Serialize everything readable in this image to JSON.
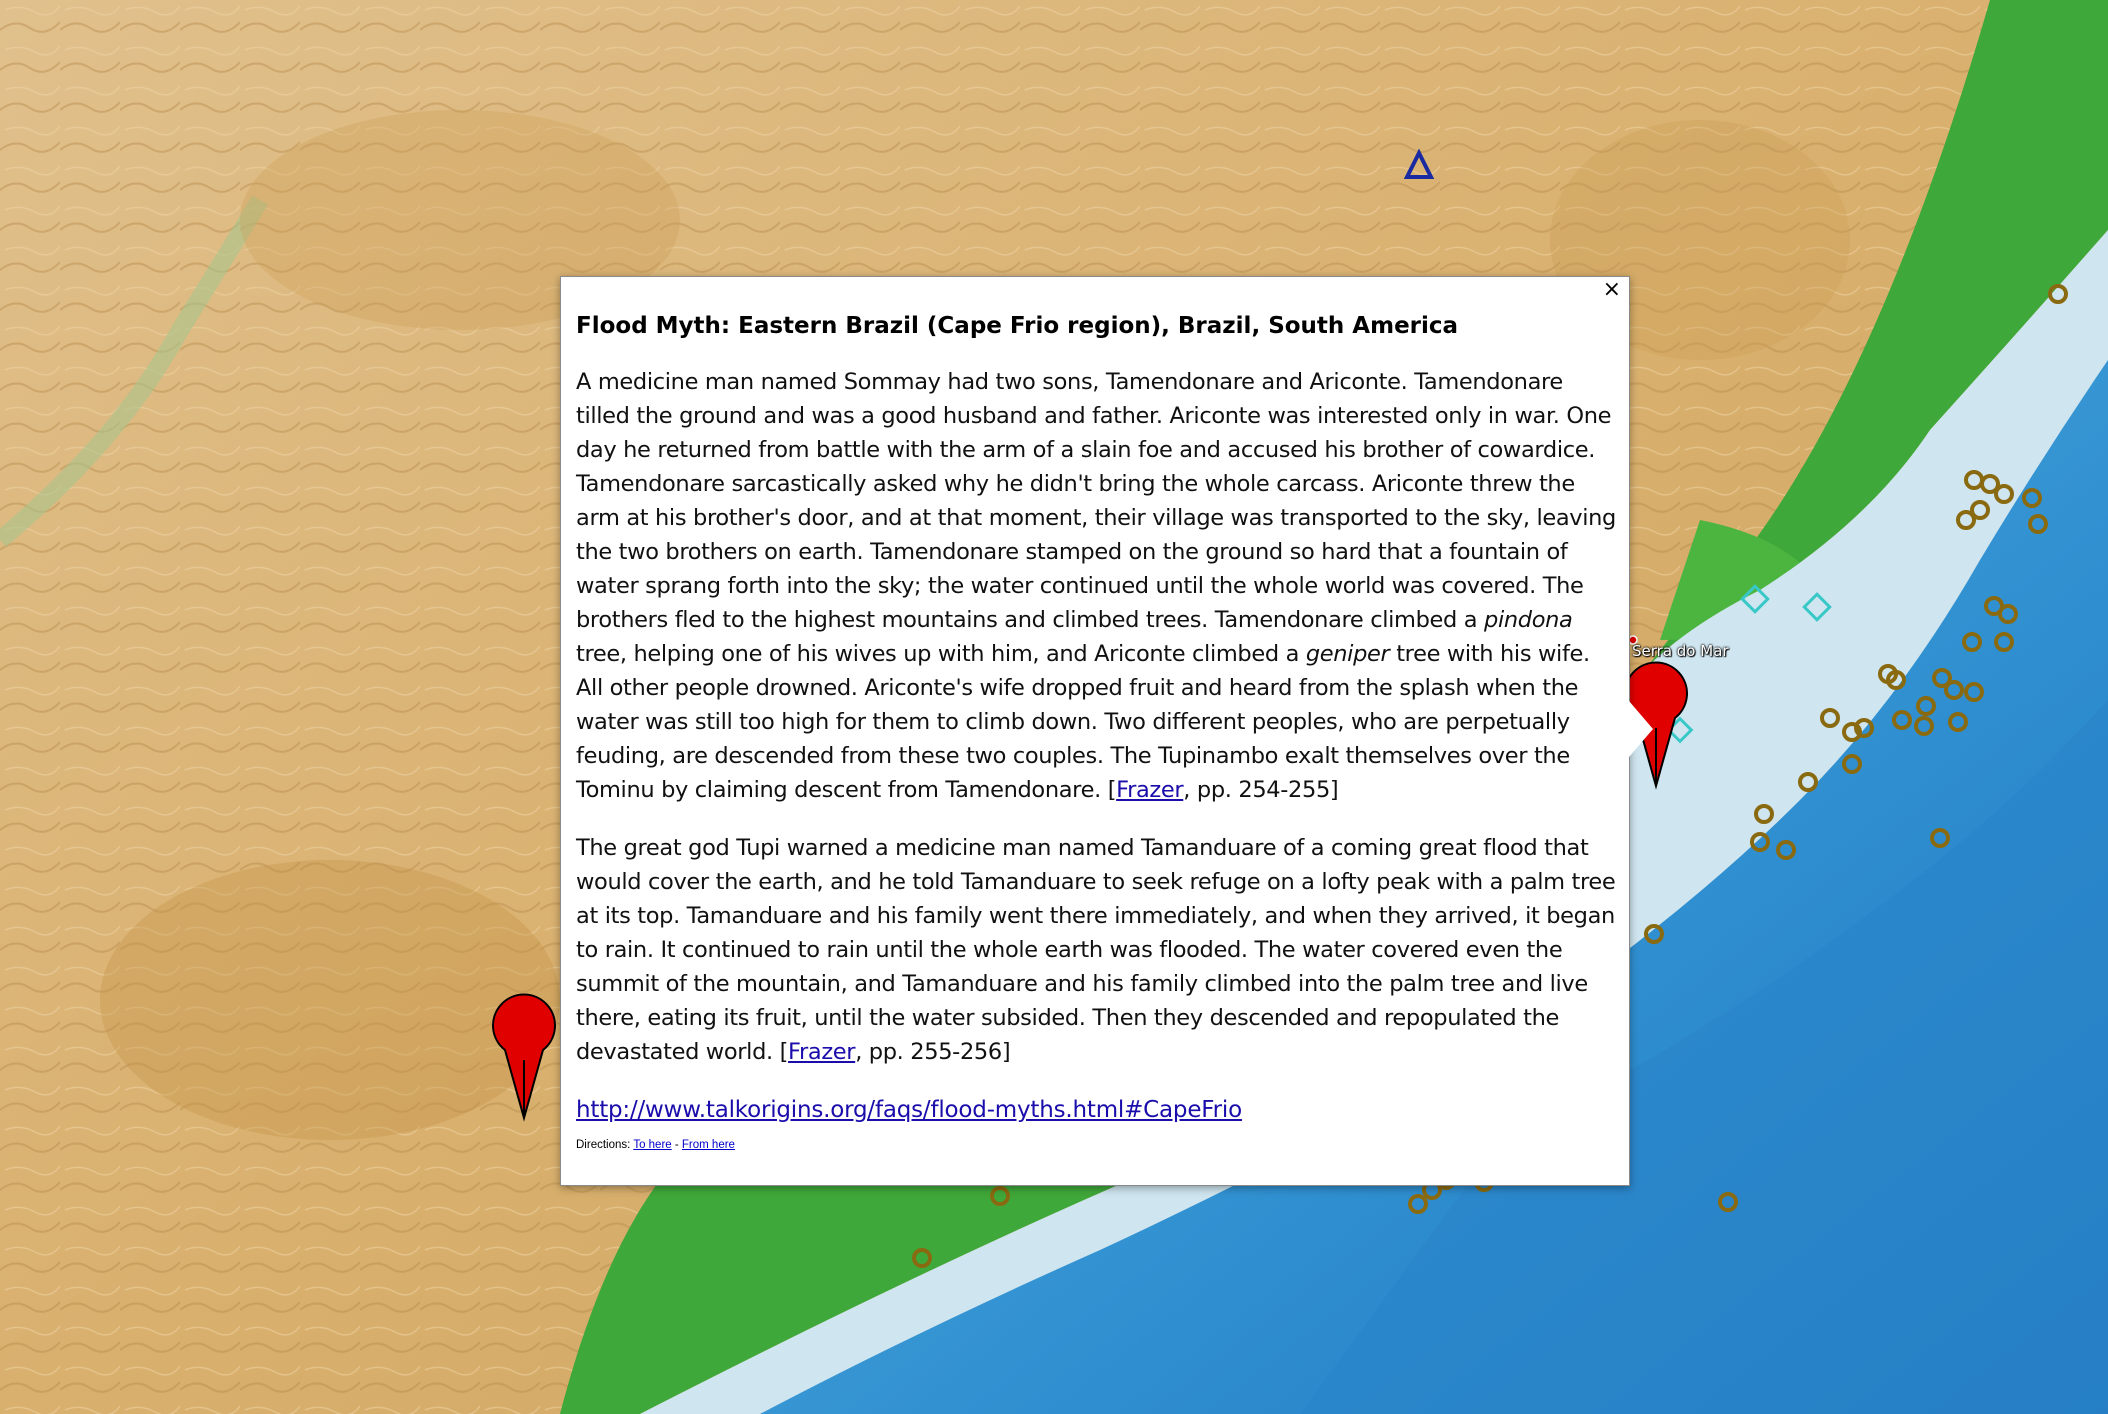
{
  "map": {
    "place_label": "Serra do Mar",
    "colors": {
      "land": "#d9b37a",
      "coastal_green": "#3fa83a",
      "shallow_sea": "#cfe5ef",
      "deep_sea": "#2f8fd0",
      "marker_red": "#e00000",
      "site_ring": "#8a6a10",
      "diamond": "#38c8c8",
      "triangle": "#1a2aa0"
    }
  },
  "popup": {
    "close_symbol": "×",
    "title": "Flood Myth: Eastern Brazil (Cape Frio region), Brazil, South America",
    "para1_a": "A medicine man named Sommay had two sons, Tamendonare and Ariconte. Tamendonare tilled the ground and was a good husband and father. Ariconte was interested only in war. One day he returned from battle with the arm of a slain foe and accused his brother of cowardice. Tamendonare sarcastically asked why he didn't bring the whole carcass. Ariconte threw the arm at his brother's door, and at that moment, their village was transported to the sky, leaving the two brothers on earth. Tamendonare stamped on the ground so hard that a fountain of water sprang forth into the sky; the water continued until the whole world was covered. The brothers fled to the highest mountains and climbed trees. Tamendonare climbed a ",
    "para1_em1": "pindona",
    "para1_b": " tree, helping one of his wives up with him, and Ariconte climbed a ",
    "para1_em2": "geniper",
    "para1_c": " tree with his wife. All other people drowned. Ariconte's wife dropped fruit and heard from the splash when the water was still too high for them to climb down. Two different peoples, who are perpetually feuding, are descended from these two couples. The Tupinambo exalt themselves over the Tominu by claiming descent from Tamendonare. [",
    "para1_link": "Frazer",
    "para1_d": ", pp. 254-255]",
    "para2_a": "The great god Tupi warned a medicine man named Tamanduare of a coming great flood that would cover the earth, and he told Tamanduare to seek refuge on a lofty peak with a palm tree at its top. Tamanduare and his family went there immediately, and when they arrived, it began to rain. It continued to rain until the whole earth was flooded. The water covered even the summit of the mountain, and Tamanduare and his family climbed into the palm tree and live there, eating its fruit, until the water subsided. Then they descended and repopulated the devastated world. [",
    "para2_link": "Frazer",
    "para2_b": ", pp. 255-256]",
    "url": "http://www.talkorigins.org/faqs/flood-myths.html#CapeFrio",
    "directions_label": "Directions: ",
    "directions_to": "To here",
    "directions_sep": " - ",
    "directions_from": "From here"
  }
}
